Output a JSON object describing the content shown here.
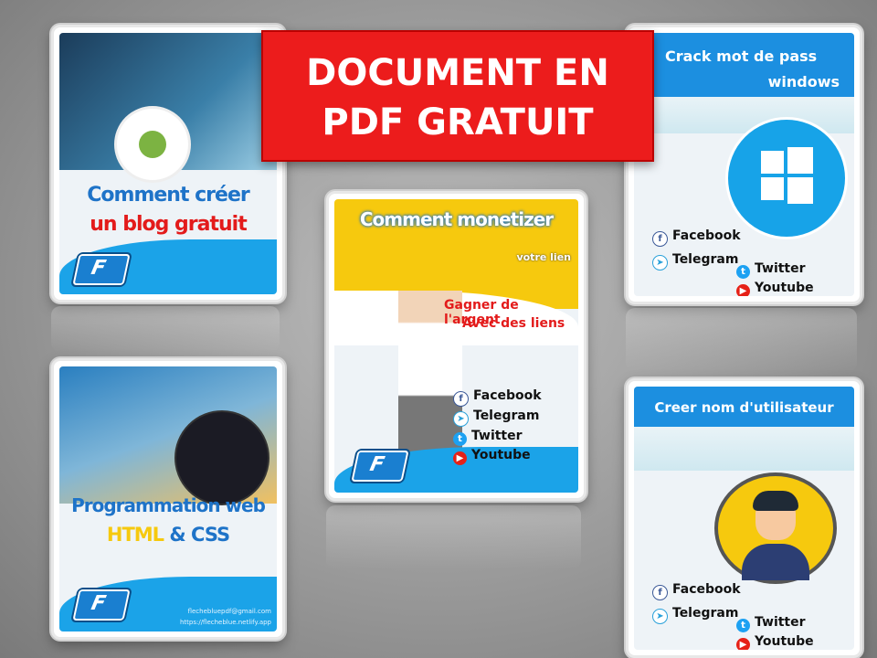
{
  "banner": {
    "line1": "DOCUMENT EN",
    "line2": "PDF GRATUIT"
  },
  "cards": {
    "blog": {
      "title1": "Comment créer",
      "title2": "un blog gratuit"
    },
    "web": {
      "title1": "Programmation web",
      "title2a": "HTML",
      "title2b": "&",
      "title2c": "CSS",
      "email": "flechebluepdf@gmail.com",
      "url": "https://flecheblue.netlify.app"
    },
    "money": {
      "title": "Comment monetizer",
      "subtitle": "votre lien",
      "pitch1": "Gagner de l'argent",
      "pitch2": "Avec des liens"
    },
    "crack": {
      "title1": "Crack mot de pass",
      "title2": "windows"
    },
    "user": {
      "title": "Creer nom d'utilisateur"
    }
  },
  "social": {
    "facebook": "Facebook",
    "telegram": "Telegram",
    "twitter": "Twitter",
    "youtube": "Youtube"
  },
  "icons": [
    "android-gear-icon",
    "laptop-icon",
    "windows-logo-icon",
    "user-avatar-icon",
    "facebook-icon",
    "telegram-icon",
    "twitter-icon",
    "youtube-icon",
    "fb-logo-icon"
  ],
  "colors": {
    "banner": "#ec1c1c",
    "blue": "#1ba3e8",
    "title_blue": "#1e73c8",
    "title_red": "#e31b1b",
    "yellow": "#f6c90e"
  }
}
